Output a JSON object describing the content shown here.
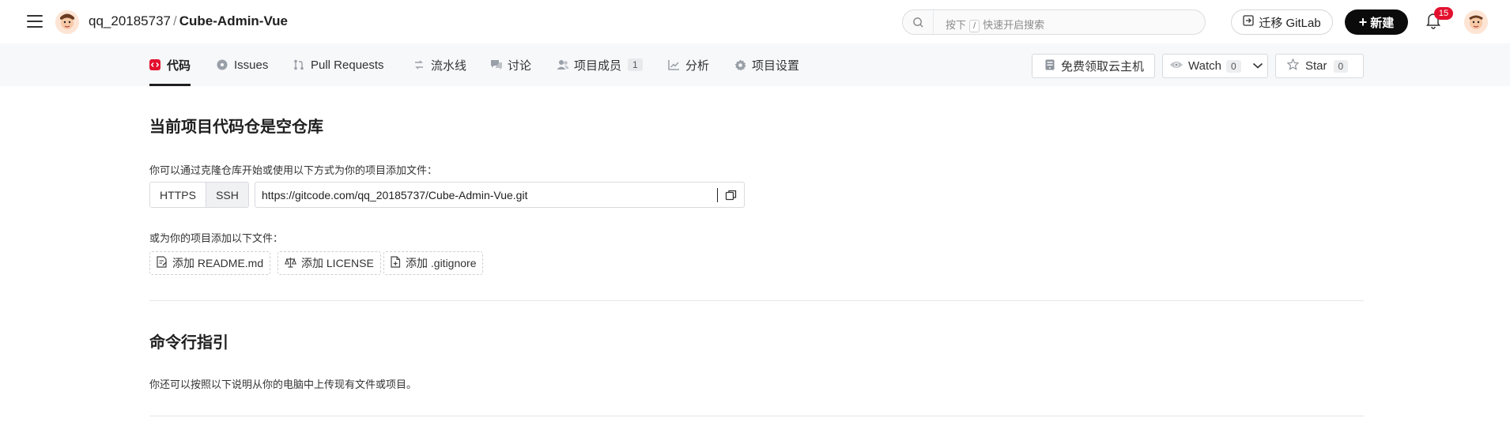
{
  "header": {
    "owner": "qq_20185737",
    "separator": "/",
    "repo_name": "Cube-Admin-Vue",
    "search": {
      "prefix": "按下",
      "key": "/",
      "suffix": "快速开启搜索"
    },
    "migrate_label": "迁移 GitLab",
    "new_label": "新建",
    "notification_count": "15"
  },
  "tabs": [
    {
      "label": "代码",
      "icon": "code-icon",
      "active": true
    },
    {
      "label": "Issues",
      "icon": "issues-icon"
    },
    {
      "label": "Pull Requests",
      "icon": "pull-request-icon"
    },
    {
      "label": "流水线",
      "icon": "pipeline-icon"
    },
    {
      "label": "讨论",
      "icon": "discussion-icon"
    },
    {
      "label": "项目成员",
      "icon": "members-icon",
      "count": "1"
    },
    {
      "label": "分析",
      "icon": "analytics-icon"
    },
    {
      "label": "项目设置",
      "icon": "settings-icon"
    }
  ],
  "actions": {
    "cloud_label": "免费领取云主机",
    "watch_label": "Watch",
    "watch_count": "0",
    "star_label": "Star",
    "star_count": "0"
  },
  "empty_repo": {
    "title": "当前项目代码仓是空仓库",
    "intro": "你可以通过克隆仓库开始或使用以下方式为你的项目添加文件：",
    "protocols": [
      "HTTPS",
      "SSH"
    ],
    "clone_url": "https://gitcode.com/qq_20185737/Cube-Admin-Vue.git",
    "add_files_label": "或为你的项目添加以下文件：",
    "add_files": [
      "添加 README.md",
      "添加 LICENSE",
      "添加 .gitignore"
    ]
  },
  "cli_guide": {
    "title": "命令行指引",
    "desc": "你还可以按照以下说明从你的电脑中上传现有文件或项目。"
  },
  "colors": {
    "accent": "#e3112f",
    "primary_button": "#0b0b0b",
    "tabbar_bg": "#f7f8fa"
  }
}
